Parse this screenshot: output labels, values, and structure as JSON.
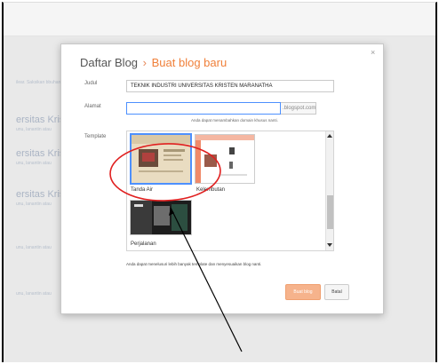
{
  "background": {
    "items": [
      {
        "title": "",
        "subtitle": "ilear. Saksikan\nbbuhan masalah"
      },
      {
        "title": "ersitas Kriste",
        "subtitle": "unu, lanantin atau"
      },
      {
        "title": "ersitas Kriste",
        "subtitle": "unu, lanantin atau"
      },
      {
        "title": "ersitas Kriste",
        "subtitle": "unu, lanantin atau"
      },
      {
        "title": "",
        "subtitle": "unu, lanantin atau"
      },
      {
        "title": "",
        "subtitle": "unu, lanantin atau"
      }
    ]
  },
  "dialog": {
    "title": "Daftar Blog",
    "separator": "›",
    "subtitle": "Buat blog baru",
    "close_label": "×",
    "fields": {
      "judul_label": "Judul",
      "judul_value": "TEKNIK INDUSTRI UNIVERSITAS KRISTEN MARANATHA",
      "alamat_label": "Alamat",
      "alamat_value": "",
      "alamat_suffix": ".blogspot.com",
      "alamat_hint": "Anda dapat menambahkan domain khusus nanti.",
      "template_label": "Template"
    },
    "templates": [
      {
        "name": "Tanda Air",
        "selected": true
      },
      {
        "name": "Kelembutan",
        "selected": false
      },
      {
        "name": "Perjalanan",
        "selected": false
      }
    ],
    "note": "Anda dapat menelusuri lebih banyak template dan menyesuaikan blog nanti.",
    "buttons": {
      "create": "Buat blog",
      "cancel": "Batal"
    }
  },
  "colors": {
    "accent": "#f0803a",
    "selection": "#4d90fe",
    "annotation_ellipse": "#e02020",
    "annotation_arrow": "#000000"
  }
}
